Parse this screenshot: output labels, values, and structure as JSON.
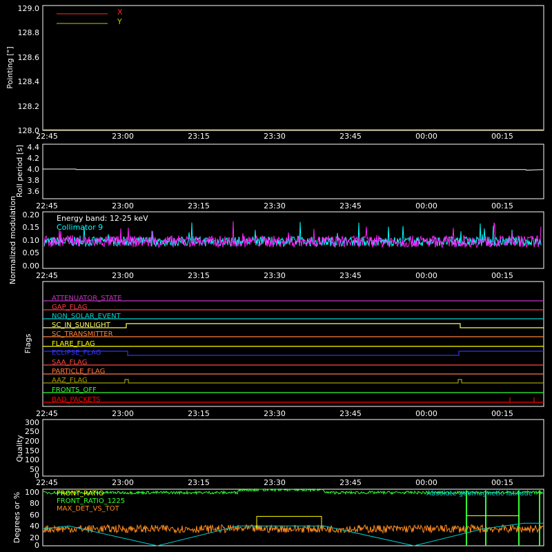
{
  "time_ticks": [
    "22:45",
    "23:00",
    "23:15",
    "23:30",
    "23:45",
    "00:00",
    "00:15"
  ],
  "chart_data": [
    {
      "type": "line",
      "ylabel": "Pointing [\"]",
      "ylim": [
        128.0,
        129.0
      ],
      "yticks": [
        "129.0",
        "128.8",
        "128.6",
        "128.4",
        "128.2",
        "128.0"
      ],
      "legend": [
        "X",
        "Y"
      ],
      "legend_colors": [
        "#ff2a2a",
        "#c8c800"
      ],
      "series": [
        {
          "name": "Y",
          "color": "#c8a020",
          "values": [
            128.0,
            128.0
          ]
        }
      ]
    },
    {
      "type": "line",
      "ylabel": "Roll period [s]",
      "ylim": [
        3.5,
        4.5
      ],
      "yticks": [
        "4.4",
        "4.2",
        "4.0",
        "3.8",
        "3.6"
      ],
      "series": [
        {
          "name": "",
          "color": "#ffffff",
          "x": [
            0,
            48,
            48.5,
            700,
            700.5,
            725
          ],
          "values": [
            4.05,
            4.05,
            4.04,
            4.04,
            4.03,
            4.04
          ]
        }
      ]
    },
    {
      "type": "line",
      "ylabel": "Normalized modulation",
      "ylim": [
        0.0,
        0.2
      ],
      "yticks": [
        "0.20",
        "0.15",
        "0.10",
        "0.05",
        "0.00"
      ],
      "annotation": "Energy band: 12-25 keV",
      "legend": [
        "Collimator 9"
      ],
      "legend_colors": [
        "#00ffff"
      ],
      "series": [
        {
          "name": "Collimator 9",
          "color": "#00ffff",
          "baseline": 0.1,
          "noise": 0.018
        },
        {
          "name": "",
          "color": "#ff22ff",
          "baseline": 0.1,
          "noise": 0.022
        }
      ]
    },
    {
      "type": "line",
      "ylabel": "Flags",
      "flags": [
        {
          "label": "ATTENUATOR_STATE",
          "color": "#c832c8"
        },
        {
          "label": "GAP_FLAG",
          "color": "#ff3c3c"
        },
        {
          "label": "NON_SOLAR_EVENT",
          "color": "#00d2d2"
        },
        {
          "label": "SC_IN_SUNLIGHT",
          "color": "#ffff64"
        },
        {
          "label": "SC_TRANSMITTER",
          "color": "#ff8232"
        },
        {
          "label": "FLARE_FLAG",
          "color": "#ffff00"
        },
        {
          "label": "ECLIPSE_FLAG",
          "color": "#3232ff"
        },
        {
          "label": "SAA_FLAG",
          "color": "#ff4646"
        },
        {
          "label": "PARTICLE_FLAG",
          "color": "#ff7840"
        },
        {
          "label": "AAZ_FLAG",
          "color": "#a0a000"
        },
        {
          "label": "FRONTS_OFF",
          "color": "#32ff32"
        },
        {
          "label": "BAD_PACKETS",
          "color": "#ff0000"
        }
      ]
    },
    {
      "type": "line",
      "ylabel": "Quality",
      "ylim": [
        0,
        300
      ],
      "yticks": [
        "300",
        "250",
        "200",
        "150",
        "100",
        "50",
        "0"
      ]
    },
    {
      "type": "line",
      "ylabel": "Degrees or %",
      "ylim": [
        0,
        100
      ],
      "yticks": [
        "100",
        "80",
        "60",
        "40",
        "20",
        "0"
      ],
      "legend": [
        "FRONT_RATIO",
        "FRONT_RATIO_1225",
        "MAX_DET_VS_TOT"
      ],
      "legend_colors": [
        "#ffff00",
        "#32ff32",
        "#ff8c1e"
      ],
      "annotation": "Absolute geomagnetic latitude",
      "annotation_color": "#00d2d2"
    }
  ]
}
